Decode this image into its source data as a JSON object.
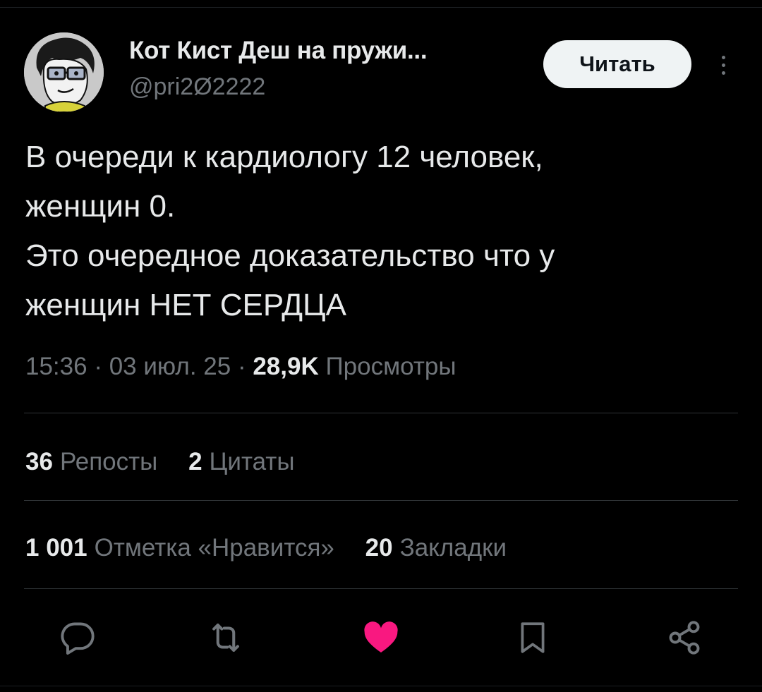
{
  "author": {
    "name": "Кот Кист Деш на пружи...",
    "handle": "@pri2Ø2222",
    "avatar_icon": "cartoon-face-with-glasses-avatar"
  },
  "follow_button": {
    "label": "Читать"
  },
  "more_icon": "vertical-ellipsis-icon",
  "tweet": {
    "lines": [
      "В очереди к кардиологу 12 человек,",
      "женщин 0.",
      "Это очередное доказательство что у",
      "женщин НЕТ СЕРДЦА"
    ]
  },
  "meta": {
    "time": "15:36",
    "separator": "·",
    "date": "03 июл. 25",
    "views_count": "28,9K",
    "views_label": "Просмотры"
  },
  "stats": {
    "reposts": {
      "count": "36",
      "label": "Репосты"
    },
    "quotes": {
      "count": "2",
      "label": "Цитаты"
    },
    "likes": {
      "count": "1 001",
      "label": "Отметка «Нравится»"
    },
    "bookmarks": {
      "count": "20",
      "label": "Закладки"
    }
  },
  "actions": [
    {
      "name": "reply",
      "icon": "speech-bubble-icon"
    },
    {
      "name": "repost",
      "icon": "repost-arrows-icon"
    },
    {
      "name": "like",
      "icon": "heart-icon",
      "active": true
    },
    {
      "name": "bookmark",
      "icon": "bookmark-icon"
    },
    {
      "name": "share",
      "icon": "share-nodes-icon"
    }
  ],
  "colors": {
    "background": "#000000",
    "text_primary": "#e7e9ea",
    "text_secondary": "#71767b",
    "divider": "#2f3336",
    "like_active": "#f91880",
    "button_bg": "#eff3f4"
  }
}
